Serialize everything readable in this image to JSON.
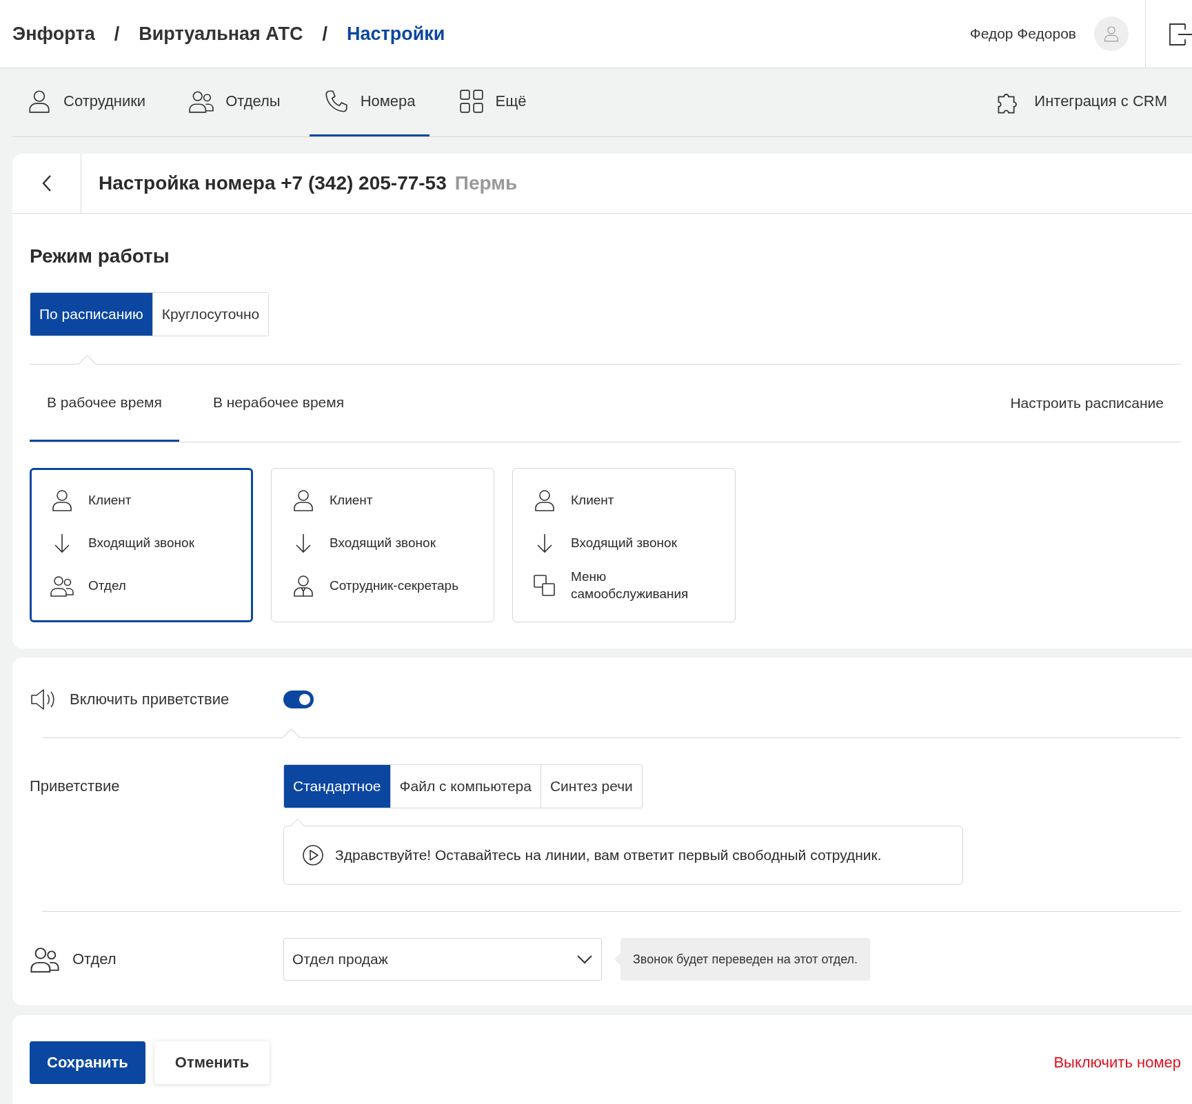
{
  "breadcrumbs": [
    {
      "label": "Энфорта",
      "selected": false
    },
    {
      "label": "Виртуальная АТС",
      "selected": false
    },
    {
      "label": "Настройки",
      "selected": true
    }
  ],
  "breadcrumb_separator": "/",
  "user": {
    "name": "Федор Федоров"
  },
  "nav": [
    {
      "kind": "person",
      "label": "Сотрудники",
      "selected": false
    },
    {
      "kind": "people",
      "label": "Отделы",
      "selected": false
    },
    {
      "kind": "phone",
      "label": "Номера",
      "selected": true
    },
    {
      "kind": "grid",
      "label": "Ещё",
      "selected": false
    }
  ],
  "nav_right": {
    "kind": "puzzle",
    "label": "Интеграция с CRM"
  },
  "page": {
    "title": "Настройка номера +7 (342) 205-77-53",
    "city": "Пермь"
  },
  "mode": {
    "title": "Режим работы",
    "options": [
      {
        "label": "По расписанию",
        "selected": true
      },
      {
        "label": "Круглосуточно",
        "selected": false
      }
    ]
  },
  "time_tabs": [
    {
      "label": "В рабочее время",
      "selected": true
    },
    {
      "label": "В нерабочее время",
      "selected": false
    }
  ],
  "schedule_link": "Настроить расписание",
  "scenarios": [
    {
      "selected": true,
      "steps": [
        {
          "kind": "person",
          "label": "Клиент"
        },
        {
          "kind": "arrow",
          "label": "Входящий звонок"
        },
        {
          "kind": "people",
          "label": "Отдел"
        }
      ]
    },
    {
      "selected": false,
      "steps": [
        {
          "kind": "person",
          "label": "Клиент"
        },
        {
          "kind": "arrow",
          "label": "Входящий звонок"
        },
        {
          "kind": "employee",
          "label": "Сотрудник-секретарь"
        }
      ]
    },
    {
      "selected": false,
      "steps": [
        {
          "kind": "person",
          "label": "Клиент"
        },
        {
          "kind": "arrow",
          "label": "Входящий звонок"
        },
        {
          "kind": "menu",
          "label": "Меню самообслуживания"
        }
      ]
    }
  ],
  "greeting": {
    "toggle_label": "Включить приветствие",
    "on": true,
    "label": "Приветствие",
    "options": [
      {
        "label": "Стандартное",
        "selected": true
      },
      {
        "label": "Файл с компьютера",
        "selected": false
      },
      {
        "label": "Синтез речи",
        "selected": false
      }
    ],
    "message": "Здравствуйте! Оставайтесь на линии, вам ответит первый свободный сотрудник."
  },
  "department": {
    "label": "Отдел",
    "value": "Отдел продаж",
    "hint": "Звонок будет переведен на этот отдел."
  },
  "actions": {
    "save": "Сохранить",
    "cancel": "Отменить",
    "disable": "Выключить номер"
  }
}
